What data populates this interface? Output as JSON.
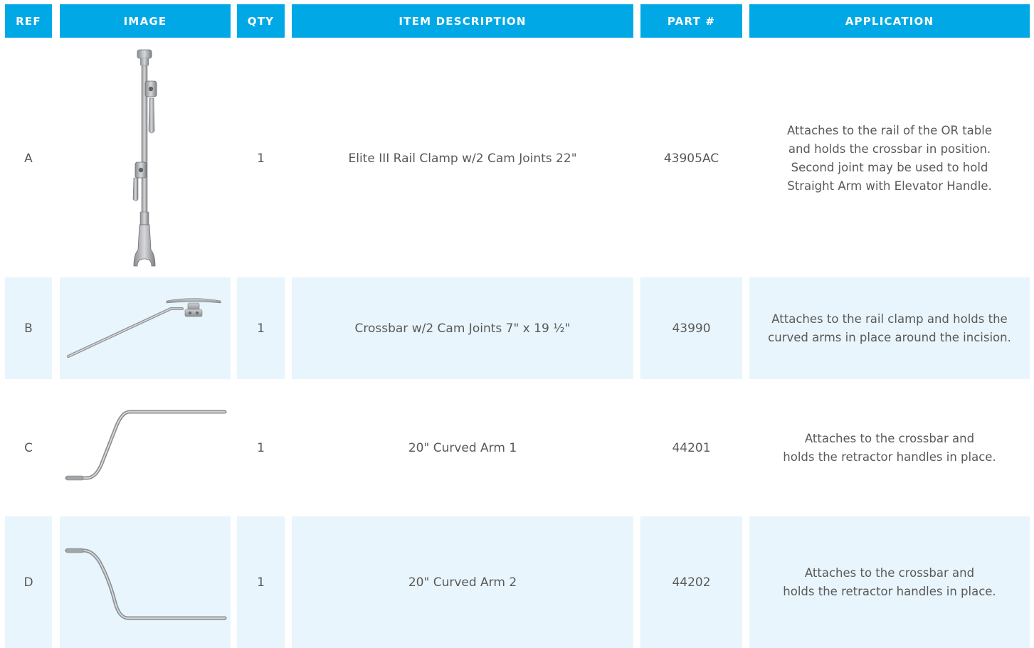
{
  "colors": {
    "header_bg": "#00a9e6",
    "row_shade": "#e8f5fc",
    "text": "#595959"
  },
  "headers": [
    "REF",
    "IMAGE",
    "QTY",
    "ITEM DESCRIPTION",
    "PART #",
    "APPLICATION"
  ],
  "rows": [
    {
      "ref": "A",
      "image": "rail-clamp-image",
      "qty": "1",
      "description": "Elite III Rail Clamp w/2 Cam Joints 22\"",
      "part": "43905AC",
      "application": "Attaches to the rail of the OR table\nand holds the crossbar in position.\nSecond joint may be used to hold\nStraight Arm with Elevator Handle."
    },
    {
      "ref": "B",
      "image": "crossbar-image",
      "qty": "1",
      "description": "Crossbar w/2 Cam Joints 7\" x 19 ½\"",
      "part": "43990",
      "application": "Attaches to the rail clamp and holds the\ncurved arms in place around the incision."
    },
    {
      "ref": "C",
      "image": "curved-arm-1-image",
      "qty": "1",
      "description": "20\" Curved Arm 1",
      "part": "44201",
      "application": "Attaches to the crossbar and\nholds the retractor handles in place."
    },
    {
      "ref": "D",
      "image": "curved-arm-2-image",
      "qty": "1",
      "description": "20\" Curved Arm 2",
      "part": "44202",
      "application": "Attaches to the crossbar and\nholds the retractor handles in place."
    }
  ]
}
